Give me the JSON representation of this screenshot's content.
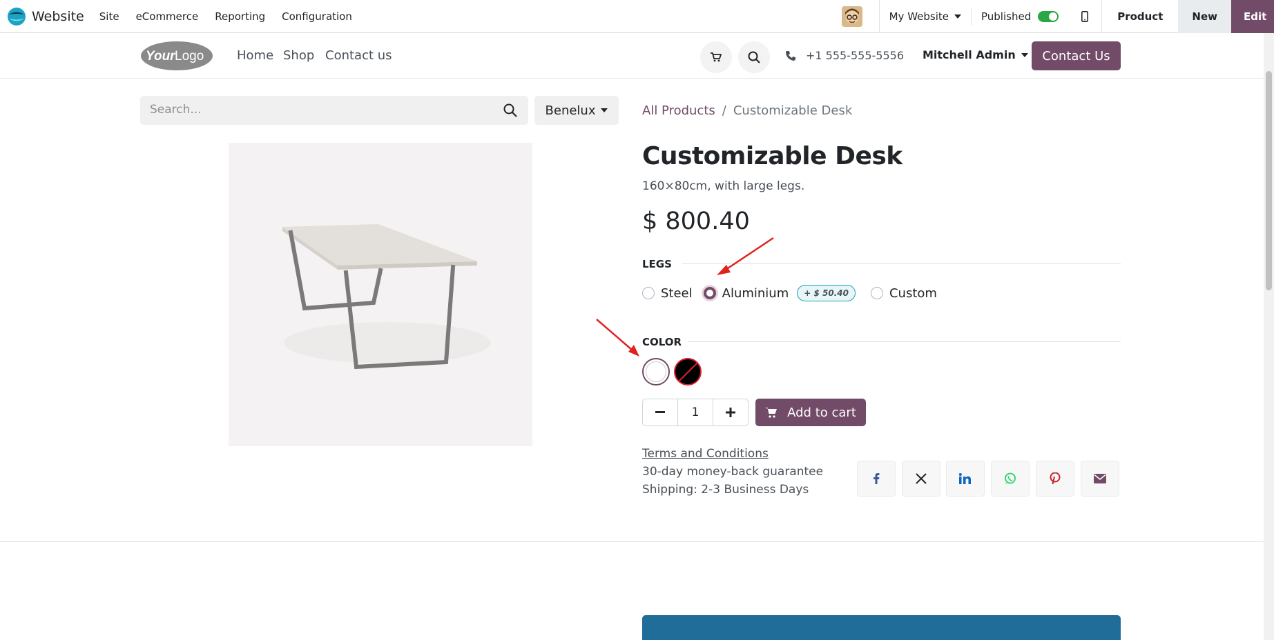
{
  "topbar": {
    "app_name": "Website",
    "menus": [
      "Site",
      "eCommerce",
      "Reporting",
      "Configuration"
    ],
    "website_selector": "My Website",
    "published_label": "Published",
    "product_label": "Product",
    "new_label": "New",
    "edit_label": "Edit"
  },
  "header": {
    "logo_text": "YourLogo",
    "nav": [
      "Home",
      "Shop",
      "Contact us"
    ],
    "phone": "+1 555-555-5556",
    "user": "Mitchell Admin",
    "contact_button": "Contact Us"
  },
  "search": {
    "placeholder": "Search...",
    "pricelist": "Benelux"
  },
  "breadcrumb": {
    "parent": "All Products",
    "separator": "/",
    "current": "Customizable Desk"
  },
  "product": {
    "name": "Customizable Desk",
    "description": "160×80cm, with large legs.",
    "price": "$ 800.40",
    "legs_label": "LEGS",
    "legs_options": [
      {
        "label": "Steel",
        "selected": false
      },
      {
        "label": "Aluminium",
        "selected": true,
        "extra": "+ $ 50.40"
      },
      {
        "label": "Custom",
        "selected": false
      }
    ],
    "color_label": "COLOR",
    "colors": [
      {
        "name": "White",
        "hex": "#ffffff",
        "selected": true
      },
      {
        "name": "Black",
        "hex": "#000000",
        "selected": false,
        "unavailable": true
      }
    ],
    "quantity": "1",
    "add_to_cart": "Add to cart",
    "terms": "Terms and Conditions",
    "guarantee": "30-day money-back guarantee",
    "shipping": "Shipping: 2-3 Business Days"
  },
  "share": [
    "facebook",
    "x",
    "linkedin",
    "whatsapp",
    "pinterest",
    "email"
  ],
  "colors": {
    "brand": "#714b67",
    "published_toggle": "#28a745",
    "annotation_arrow": "#e0221f",
    "banner": "#1f6d98"
  }
}
